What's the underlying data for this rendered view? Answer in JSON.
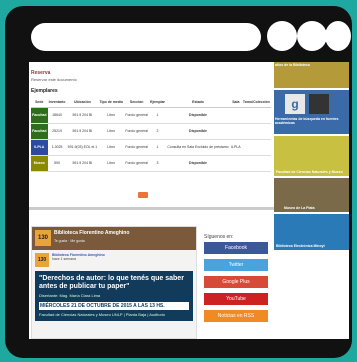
{
  "reserva": {
    "title": "Reserva",
    "subtitle": "Reservar este documento"
  },
  "ejemplares": {
    "title": "Ejemplares",
    "headers": [
      "Sede",
      "Inventario",
      "Ubicación",
      "Tipo de medio",
      "Sección",
      "Ejemplar",
      "Estado",
      "Sala",
      "Tomo/Colección"
    ],
    "rows": [
      {
        "sede": "Facultad",
        "inv": "18640",
        "ubic": "591.9 204 BI",
        "tipo": "Libro",
        "secc": "Fondo general",
        "ej": "1",
        "estado": "Disponible",
        "sala": "",
        "tomo": ""
      },
      {
        "sede": "Facultad",
        "inv": "25219",
        "ubic": "591.9 204 BI",
        "tipo": "Libro",
        "secc": "Fondo general",
        "ej": "2",
        "estado": "Disponible",
        "sala": "",
        "tomo": ""
      },
      {
        "sede": "ILPLA",
        "inv": "1-0025",
        "ubic": "591.9(03) EOL el.1",
        "tipo": "Libro",
        "secc": "Fondo general",
        "ej": "1",
        "estado": "Consulta en Sala Excluido de préstamo",
        "sala": "ILPLA",
        "tomo": ""
      },
      {
        "sede": "Museo",
        "inv": "590",
        "ubic": "591.9 204 BI",
        "tipo": "Libro",
        "secc": "Fondo general",
        "ej": "3",
        "estado": "Disponible",
        "sala": "",
        "tomo": ""
      }
    ]
  },
  "facebook": {
    "logo": "130",
    "page_name": "Biblioteca Florentino Ameghino",
    "meta": "Te gusta · Me gusta",
    "post_name": "Biblioteca Florentino Ameghino",
    "post_meta": "hace 1 semana",
    "post_title": "\"Derechos de autor: lo que tenés que saber antes de publicar tu paper\"",
    "post_speaker": "Disertante: Mag. María Clara Lima",
    "post_when": "MIÉRCOLES 21 DE OCTUBRE DE 2015 A LAS 13 HS.",
    "post_where": "Facultad de Ciencias Naturales y Museo UNLP | Planta Baja | Auditorio"
  },
  "social": {
    "label": "Síguenos en:",
    "buttons": [
      {
        "name": "facebook-button",
        "label": "Facebook",
        "color": "#3b5998"
      },
      {
        "name": "twitter-button",
        "label": "Twitter",
        "color": "#4aa3df"
      },
      {
        "name": "google-plus-button",
        "label": "Google Plus",
        "color": "#d84a38"
      },
      {
        "name": "youtube-button",
        "label": "YouTube",
        "color": "#cc2222"
      },
      {
        "name": "rss-button",
        "label": "Noticias en RSS",
        "color": "#f08a24"
      }
    ]
  },
  "sidebar": {
    "items": [
      {
        "label": "años de la Biblioteca",
        "color": "#b59a3a"
      },
      {
        "label": "Herramientas de búsqueda en fuentes académicas",
        "color": "#3a6aa8"
      },
      {
        "label": "Facultad de Ciencias Naturales y Museo",
        "color": "#c8c040"
      },
      {
        "label": "Museo de La Plata",
        "color": "#7a6a4a"
      },
      {
        "label": "Biblioteca Electrónica Mincyt",
        "color": "#2a7ab8"
      }
    ]
  }
}
